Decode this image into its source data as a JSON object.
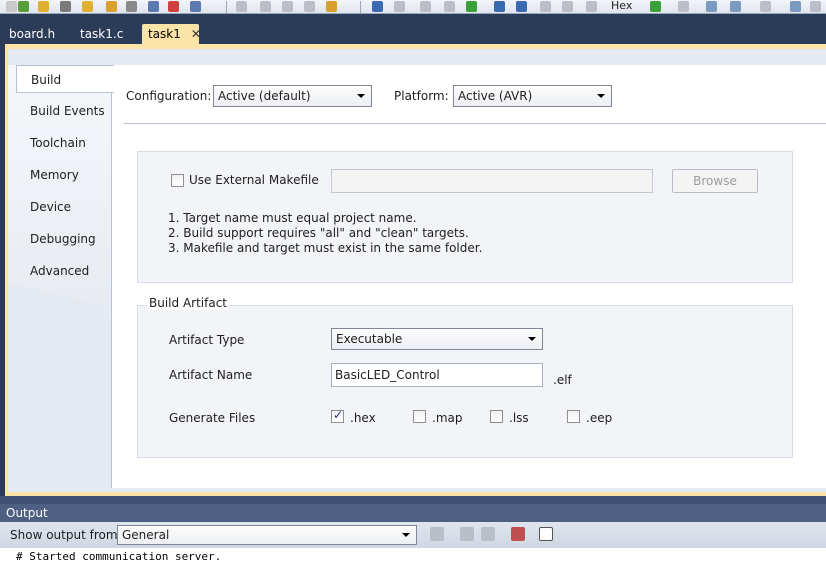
{
  "toolbar": {
    "hex_label": "Hex"
  },
  "doc_tabs": [
    {
      "label": "board.h"
    },
    {
      "label": "task1.c"
    },
    {
      "label": "task1",
      "close_icon": "close-icon",
      "active": true
    }
  ],
  "side_tabs": [
    {
      "label": "Build",
      "active": true
    },
    {
      "label": "Build Events"
    },
    {
      "label": "Toolchain"
    },
    {
      "label": "Memory"
    },
    {
      "label": "Device"
    },
    {
      "label": "Debugging"
    },
    {
      "label": "Advanced"
    }
  ],
  "build": {
    "configuration_label": "Configuration:",
    "configuration_value": "Active (default)",
    "platform_label": "Platform:",
    "platform_value": "Active (AVR)",
    "use_external_makefile_label": "Use External Makefile",
    "use_external_makefile_checked": false,
    "makefile_path_value": "",
    "browse_label": "Browse",
    "notes": [
      "1. Target name must equal project name.",
      "2. Build support requires \"all\" and \"clean\" targets.",
      "3. Makefile and target must exist in the same folder."
    ],
    "build_artifact_title": "Build Artifact",
    "artifact_type_label": "Artifact Type",
    "artifact_type_value": "Executable",
    "artifact_name_label": "Artifact Name",
    "artifact_name_value": "BasicLED_Control",
    "artifact_ext": ".elf",
    "generate_files_label": "Generate Files",
    "generate_files": [
      {
        "label": ".hex",
        "checked": true
      },
      {
        "label": ".map",
        "checked": false
      },
      {
        "label": ".lss",
        "checked": false
      },
      {
        "label": ".eep",
        "checked": false
      }
    ]
  },
  "output": {
    "title": "Output",
    "show_output_from_label": "Show output from:",
    "source_value": "General",
    "text": "# Started communication server."
  },
  "colors": {
    "frame": "#2b3c59",
    "active_tab": "#fce4a8",
    "output_title": "#4d6082"
  }
}
